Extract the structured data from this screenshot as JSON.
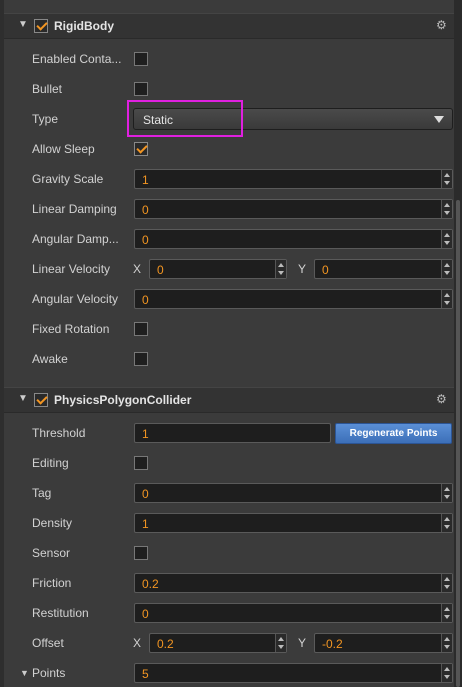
{
  "rigidbody": {
    "title": "RigidBody",
    "enabled": true,
    "fields": {
      "enabled_contact": {
        "label": "Enabled Conta...",
        "checked": false
      },
      "bullet": {
        "label": "Bullet",
        "checked": false
      },
      "type": {
        "label": "Type",
        "value": "Static"
      },
      "allow_sleep": {
        "label": "Allow Sleep",
        "checked": true
      },
      "gravity_scale": {
        "label": "Gravity Scale",
        "value": "1"
      },
      "linear_damping": {
        "label": "Linear Damping",
        "value": "0"
      },
      "angular_damping": {
        "label": "Angular Damp...",
        "value": "0"
      },
      "linear_velocity": {
        "label": "Linear Velocity",
        "x_label": "X",
        "x": "0",
        "y_label": "Y",
        "y": "0"
      },
      "angular_velocity": {
        "label": "Angular Velocity",
        "value": "0"
      },
      "fixed_rotation": {
        "label": "Fixed Rotation",
        "checked": false
      },
      "awake": {
        "label": "Awake",
        "checked": false
      }
    }
  },
  "collider": {
    "title": "PhysicsPolygonCollider",
    "enabled": true,
    "fields": {
      "threshold": {
        "label": "Threshold",
        "value": "1",
        "button": "Regenerate Points"
      },
      "editing": {
        "label": "Editing",
        "checked": false
      },
      "tag": {
        "label": "Tag",
        "value": "0"
      },
      "density": {
        "label": "Density",
        "value": "1"
      },
      "sensor": {
        "label": "Sensor",
        "checked": false
      },
      "friction": {
        "label": "Friction",
        "value": "0.2"
      },
      "restitution": {
        "label": "Restitution",
        "value": "0"
      },
      "offset": {
        "label": "Offset",
        "x_label": "X",
        "x": "0.2",
        "y_label": "Y",
        "y": "-0.2"
      },
      "points": {
        "label": "Points",
        "value": "5"
      }
    }
  },
  "icons": {
    "collapse": "triangle-down",
    "settings": "gear"
  },
  "colors": {
    "accent": "#f29522",
    "highlight": "#e020e0",
    "button": "#4a7fc7"
  }
}
